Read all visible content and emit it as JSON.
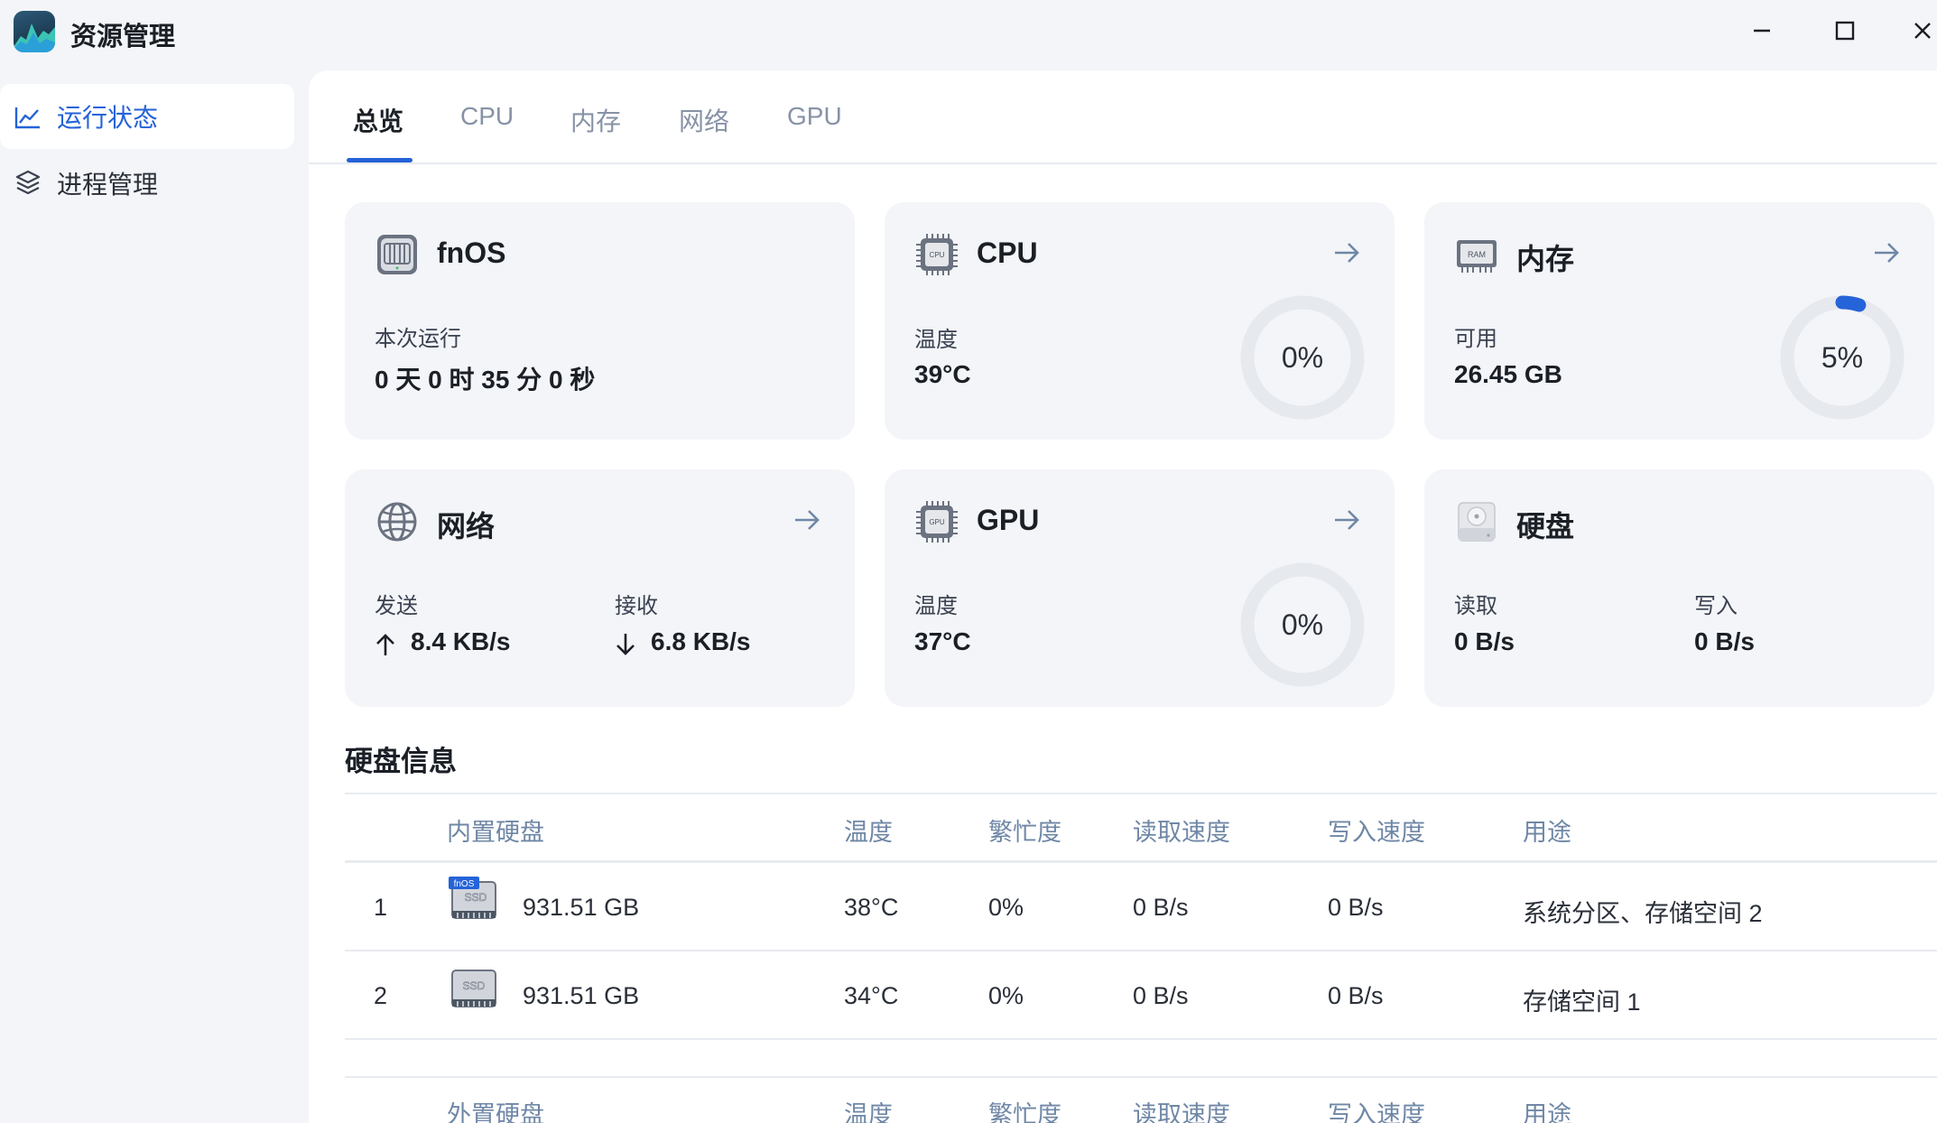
{
  "app": {
    "title": "资源管理",
    "icon": "activity-chart-app-icon"
  },
  "window_controls": {
    "minimize": "minimize-icon",
    "maximize": "maximize-icon",
    "close": "close-icon"
  },
  "sidebar": {
    "items": [
      {
        "label": "运行状态",
        "icon": "line-chart-icon",
        "active": true
      },
      {
        "label": "进程管理",
        "icon": "layers-icon",
        "active": false
      }
    ]
  },
  "tabs": [
    {
      "label": "总览",
      "active": true
    },
    {
      "label": "CPU",
      "active": false
    },
    {
      "label": "内存",
      "active": false
    },
    {
      "label": "网络",
      "active": false
    },
    {
      "label": "GPU",
      "active": false
    }
  ],
  "cards": {
    "fnos": {
      "title": "fnOS",
      "label": "本次运行",
      "value": "0 天 0 时 35 分 0 秒"
    },
    "cpu": {
      "title": "CPU",
      "label": "温度",
      "value": "39°C",
      "gauge_text": "0%",
      "gauge_fraction": 0.0
    },
    "memory": {
      "title": "内存",
      "label": "可用",
      "value": "26.45 GB",
      "gauge_text": "5%",
      "gauge_fraction": 0.05
    },
    "network": {
      "title": "网络",
      "send_label": "发送",
      "send_value": "8.4 KB/s",
      "recv_label": "接收",
      "recv_value": "6.8 KB/s"
    },
    "gpu": {
      "title": "GPU",
      "label": "温度",
      "value": "37°C",
      "gauge_text": "0%",
      "gauge_fraction": 0.0
    },
    "disk": {
      "title": "硬盘",
      "read_label": "读取",
      "read_value": "0 B/s",
      "write_label": "写入",
      "write_value": "0 B/s"
    }
  },
  "disk_info": {
    "title": "硬盘信息",
    "internal_headers": [
      "内置硬盘",
      "温度",
      "繁忙度",
      "读取速度",
      "写入速度",
      "用途"
    ],
    "rows": [
      {
        "index": "1",
        "badge": "fnOS",
        "icon_label": "SSD",
        "size": "931.51 GB",
        "temp": "38°C",
        "busy": "0%",
        "read": "0 B/s",
        "write": "0 B/s",
        "usage": "系统分区、存储空间 2"
      },
      {
        "index": "2",
        "badge": "",
        "icon_label": "SSD",
        "size": "931.51 GB",
        "temp": "34°C",
        "busy": "0%",
        "read": "0 B/s",
        "write": "0 B/s",
        "usage": "存储空间 1"
      }
    ],
    "external_headers": [
      "外置硬盘",
      "温度",
      "繁忙度",
      "读取速度",
      "写入速度",
      "用途"
    ]
  },
  "colors": {
    "accent": "#2563d8",
    "background": "#f3f5f8",
    "card": "#f3f5f8",
    "header_text": "#6f87a6",
    "gauge_track": "#e6e9ee"
  }
}
